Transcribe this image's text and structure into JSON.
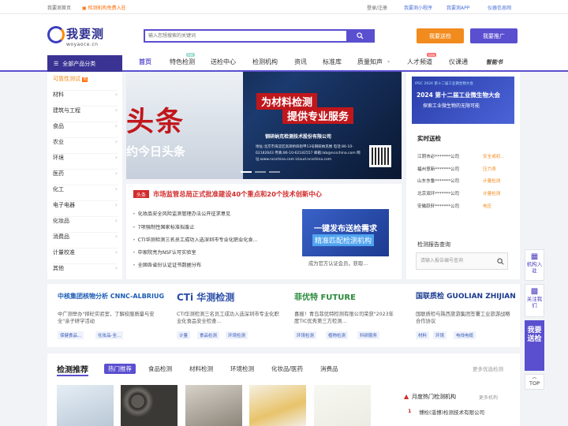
{
  "topbar": {
    "home": "我要测首页",
    "join": "检测机构免费入驻",
    "login": "登录/注册",
    "mini": "我要测小程序",
    "app": "我要测APP",
    "instrument": "仪器信息网"
  },
  "header": {
    "logo": "我要测",
    "logo_sub": "woyaoce.cn",
    "search_placeholder": "输入您想搜索的关键词",
    "btn_test": "我要送检",
    "btn_promote": "我要推广"
  },
  "nav": {
    "all_categories": "全部产品分类",
    "items": [
      "首页",
      "特色检测",
      "送检中心",
      "检测机构",
      "资讯",
      "标准库",
      "质量知声",
      "人才频道",
      "仪课通"
    ],
    "hot": "hot",
    "new_badge": "new",
    "brand": "智能书"
  },
  "sidebar": {
    "items": [
      "可靠性测试",
      "材料",
      "建筑与工程",
      "食品",
      "农业",
      "环境",
      "医药",
      "化工",
      "电子电器",
      "化妆品",
      "消费品",
      "计量校准",
      "其他"
    ],
    "badge": "热"
  },
  "banner": {
    "big": "头条",
    "sub": "约今日头条",
    "h1": "为材料检测",
    "h2": "提供专业服务",
    "company": "钢研纳克检测技术股份有限公司",
    "info": "地址:北京市海淀区高梁桥斜街甲13号钢研纳克楼 电话:86-10-62182643 传真:86-10-62182557 邮箱:lab@ncschina.com 网址:www.ncschina.com icloud.ncschina.com"
  },
  "news": {
    "tag": "头条",
    "headline": "市场监管总局正式批准建设40个重点和20个技术创新中心",
    "items": [
      "化妆品安全风险监测管理办法公开征求意见",
      "7项强制性国家标准拟废止",
      "CTI华测检测三名员工成功入选深圳市专业化职业化食...",
      "中家院亮为NSF认可实验室",
      "全国各省份认证证书数据分布"
    ],
    "promo_t1": "一键发布送检需求",
    "promo_t2": "精准匹配检测机构",
    "promo_caption": "成为官方认证会员，获取..."
  },
  "right": {
    "banner_year": "IPSC 2024 第十二届工业微生物大会",
    "banner_title": "2024 第十二届工业微生物大会",
    "banner_sub": "探索工业微生物的无限可能",
    "realtime_title": "实时送检",
    "rows": [
      [
        "江阴市必*******公司",
        "安全或初..."
      ],
      [
        "福州意新*******公司",
        "压力表"
      ],
      [
        "山东东鲁*******公司",
        "计量检测"
      ],
      [
        "北京双环*******公司",
        "计量检测"
      ],
      [
        "安徽跃轩*******公司",
        "电压"
      ]
    ],
    "query_title": "检测报告查询",
    "query_placeholder": "请输入报告编号查询"
  },
  "cards": [
    {
      "logo": "中核集团核物分析 CNNC-ALBRIUG",
      "text": "中广测举办\"择砼实验室，了解校服质量与安全\"亲子研学活动",
      "chips": [
        "保健食品...",
        "化妆品-全..."
      ]
    },
    {
      "logo": "CTi 华测检测",
      "text": "CTI华测检测三名员工成功入选深圳市专业化职业化食品安全检查...",
      "chips": [
        "计量",
        "食品检测",
        "环境检测"
      ]
    },
    {
      "logo": "菲优特 FUTURE",
      "text": "喜报！青岛菲优特检测有限公司荣获\"2023年度TIC优秀第三方检测...",
      "chips": [
        "环境检测",
        "植物检测",
        "科研服务"
      ]
    },
    {
      "logo": "国联质检 GUOLIAN ZHIJIAN",
      "text": "国联质检与陕西旅游集团签署工业旅游战略合作协议",
      "chips": [
        "材料",
        "环境",
        "电线电缆"
      ]
    }
  ],
  "recommend": {
    "title": "检测推荐",
    "tabs": [
      "热门推荐",
      "食品检测",
      "材料检测",
      "环境检测",
      "化妆品/医药",
      "消费品"
    ],
    "more": "更多优选检测",
    "hot_title": "月度热门检测机构",
    "hot_more": "更多机构",
    "hot_item": "博检(淄博)检测技术有限公司"
  },
  "float": {
    "join": "机构入驻",
    "follow": "关注我们",
    "cta": "我要送检",
    "top": "TOP"
  },
  "colors": {
    "primary": "#5a4fcf",
    "orange": "#f28b1d",
    "red": "#d22b2b"
  }
}
